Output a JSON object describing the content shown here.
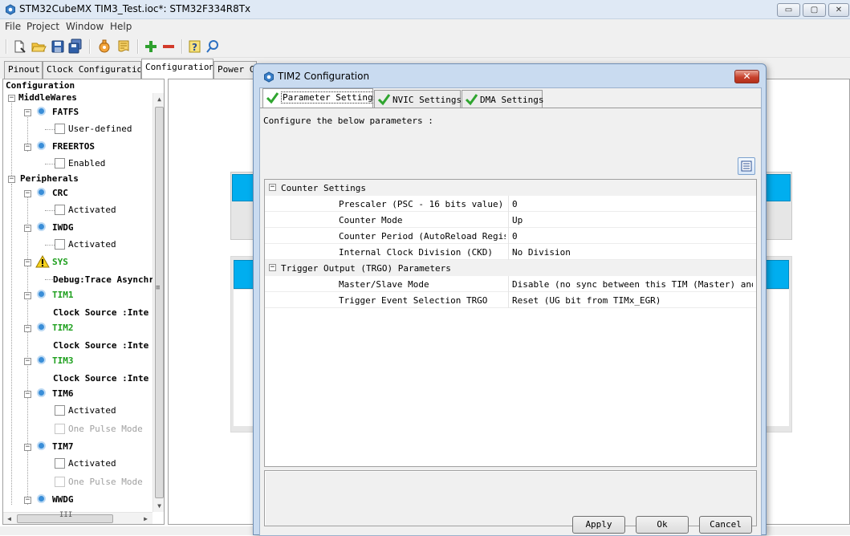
{
  "window": {
    "title": "STM32CubeMX TIM3_Test.ioc*: STM32F334R8Tx",
    "controls": {
      "minimize": "▭",
      "maximize": "▢",
      "close": "✕"
    }
  },
  "menu": [
    "File",
    "Project",
    "Window",
    "Help"
  ],
  "toolbar_icons": [
    "new-project-icon",
    "open-project-icon",
    "save-icon",
    "save-as-icon",
    "generate-report-icon",
    "generate-code-icon",
    "add-icon",
    "remove-icon",
    "help-icon",
    "about-icon"
  ],
  "main_tabs": [
    "Pinout",
    "Clock Configuration",
    "Configuration",
    "Power C"
  ],
  "tree": {
    "root": "Configuration",
    "middlewares": {
      "label": "MiddleWares",
      "fatfs": {
        "label": "FATFS",
        "option": "User-defined"
      },
      "freertos": {
        "label": "FREERTOS",
        "option": "Enabled"
      }
    },
    "peripherals": {
      "label": "Peripherals",
      "crc": {
        "label": "CRC",
        "option": "Activated"
      },
      "iwdg": {
        "label": "IWDG",
        "option": "Activated"
      },
      "sys": {
        "label": "SYS",
        "detail": "Debug:Trace Asynchr"
      },
      "tim1": {
        "label": "TIM1",
        "detail": "Clock Source :Inte"
      },
      "tim2": {
        "label": "TIM2",
        "detail": "Clock Source :Inte"
      },
      "tim3": {
        "label": "TIM3",
        "detail": "Clock Source :Inte"
      },
      "tim6": {
        "label": "TIM6",
        "option1": "Activated",
        "option2": "One Pulse Mode"
      },
      "tim7": {
        "label": "TIM7",
        "option1": "Activated",
        "option2": "One Pulse Mode"
      },
      "wwdg": {
        "label": "WWDG"
      }
    },
    "scroll": {
      "up": "▲",
      "down": "▼",
      "left": "◀",
      "right": "▶",
      "grip_v": "≡",
      "grip_h": "III"
    }
  },
  "dialog": {
    "title": "TIM2 Configuration",
    "close": "✕",
    "tabs": [
      "Parameter Settings",
      "NVIC Settings",
      "DMA Settings"
    ],
    "instruction": "Configure the below parameters :",
    "groups": [
      {
        "label": "Counter Settings",
        "params": [
          {
            "name": "Prescaler (PSC - 16 bits value)",
            "value": "0"
          },
          {
            "name": "Counter Mode",
            "value": "Up"
          },
          {
            "name": "Counter Period (AutoReload Regis...",
            "value": "0"
          },
          {
            "name": "Internal Clock Division (CKD)",
            "value": "No Division"
          }
        ]
      },
      {
        "label": "Trigger Output (TRGO) Parameters",
        "params": [
          {
            "name": "Master/Slave Mode",
            "value": "Disable (no sync between this TIM (Master) and ..."
          },
          {
            "name": "Trigger Event Selection TRGO",
            "value": "Reset (UG bit from TIMx_EGR)"
          }
        ]
      }
    ],
    "collapse_glyph": "−",
    "buttons": {
      "apply": "Apply",
      "ok": "Ok",
      "cancel": "Cancel"
    }
  },
  "colors": {
    "accent_cyan": "#00aeef",
    "success_green": "#1fa01f",
    "dialog_frame": "#c9dbf0",
    "close_red": "#c7412c"
  }
}
